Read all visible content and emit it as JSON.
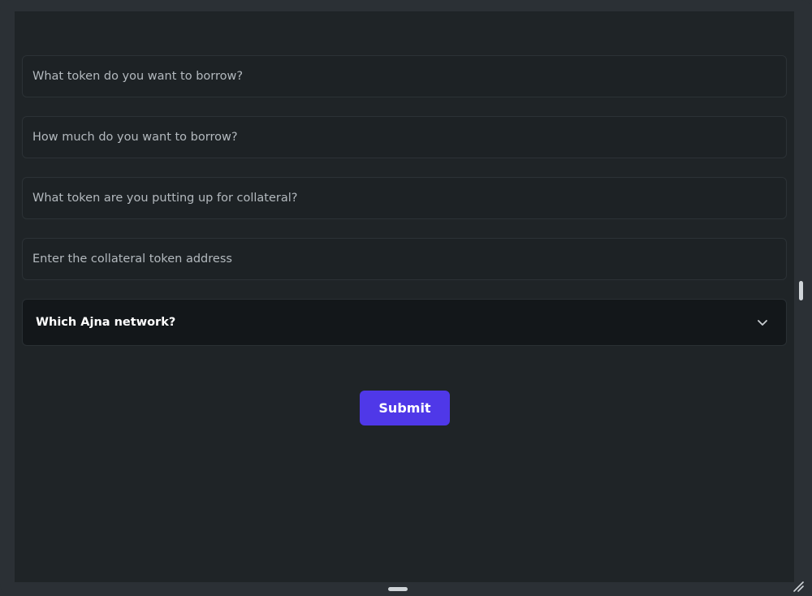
{
  "form": {
    "borrow_token": {
      "placeholder": "What token do you want to borrow?",
      "value": ""
    },
    "borrow_amount": {
      "placeholder": "How much do you want to borrow?",
      "value": ""
    },
    "collateral_token": {
      "placeholder": "What token are you putting up for collateral?",
      "value": ""
    },
    "collateral_address": {
      "placeholder": "Enter the collateral token address",
      "value": ""
    },
    "network_select": {
      "label": "Which Ajna network?"
    },
    "submit_label": "Submit"
  },
  "icons": {
    "select_chevron": "chevron-down-icon",
    "resize": "resize-grip-icon"
  },
  "colors": {
    "background": "#1f2427",
    "frame": "#2b3035",
    "field_bg": "#1d2225",
    "select_bg": "#13171a",
    "accent": "#4f38e8",
    "text": "#ffffff",
    "placeholder": "#b3b9be"
  }
}
